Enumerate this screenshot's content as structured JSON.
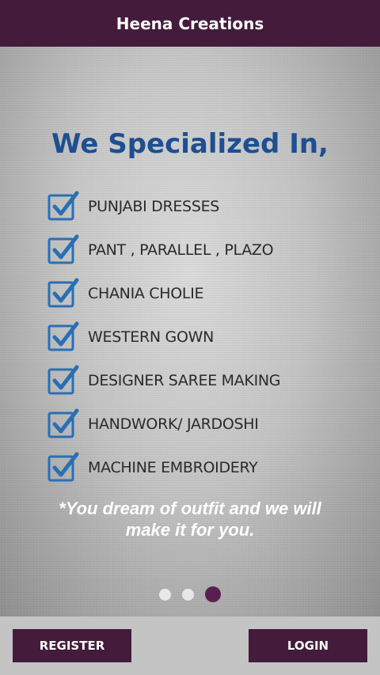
{
  "app_bar": {
    "title": "Heena Creations"
  },
  "slide": {
    "heading": "We Specialized In,",
    "items": [
      {
        "label": "PUNJABI DRESSES",
        "icon": "checkbox-checked-icon"
      },
      {
        "label": "PANT , PARALLEL , PLAZO",
        "icon": "checkbox-checked-icon"
      },
      {
        "label": "CHANIA CHOLIE",
        "icon": "checkbox-checked-icon"
      },
      {
        "label": "WESTERN GOWN",
        "icon": "checkbox-checked-icon"
      },
      {
        "label": "DESIGNER SAREE MAKING",
        "icon": "checkbox-checked-icon"
      },
      {
        "label": "HANDWORK/ JARDOSHI",
        "icon": "checkbox-checked-icon"
      },
      {
        "label": "MACHINE EMBROIDERY",
        "icon": "checkbox-checked-icon"
      }
    ],
    "tagline_line1": "*You dream of outfit and we will",
    "tagline_line2": "make it for you."
  },
  "pager": {
    "total": 3,
    "current": 3
  },
  "buttons": {
    "register": "REGISTER",
    "login": "LOGIN"
  },
  "colors": {
    "primary": "#441b3a",
    "heading": "#1d4f91",
    "check": "#2a6fb3",
    "active_dot": "#5a1f4e"
  }
}
